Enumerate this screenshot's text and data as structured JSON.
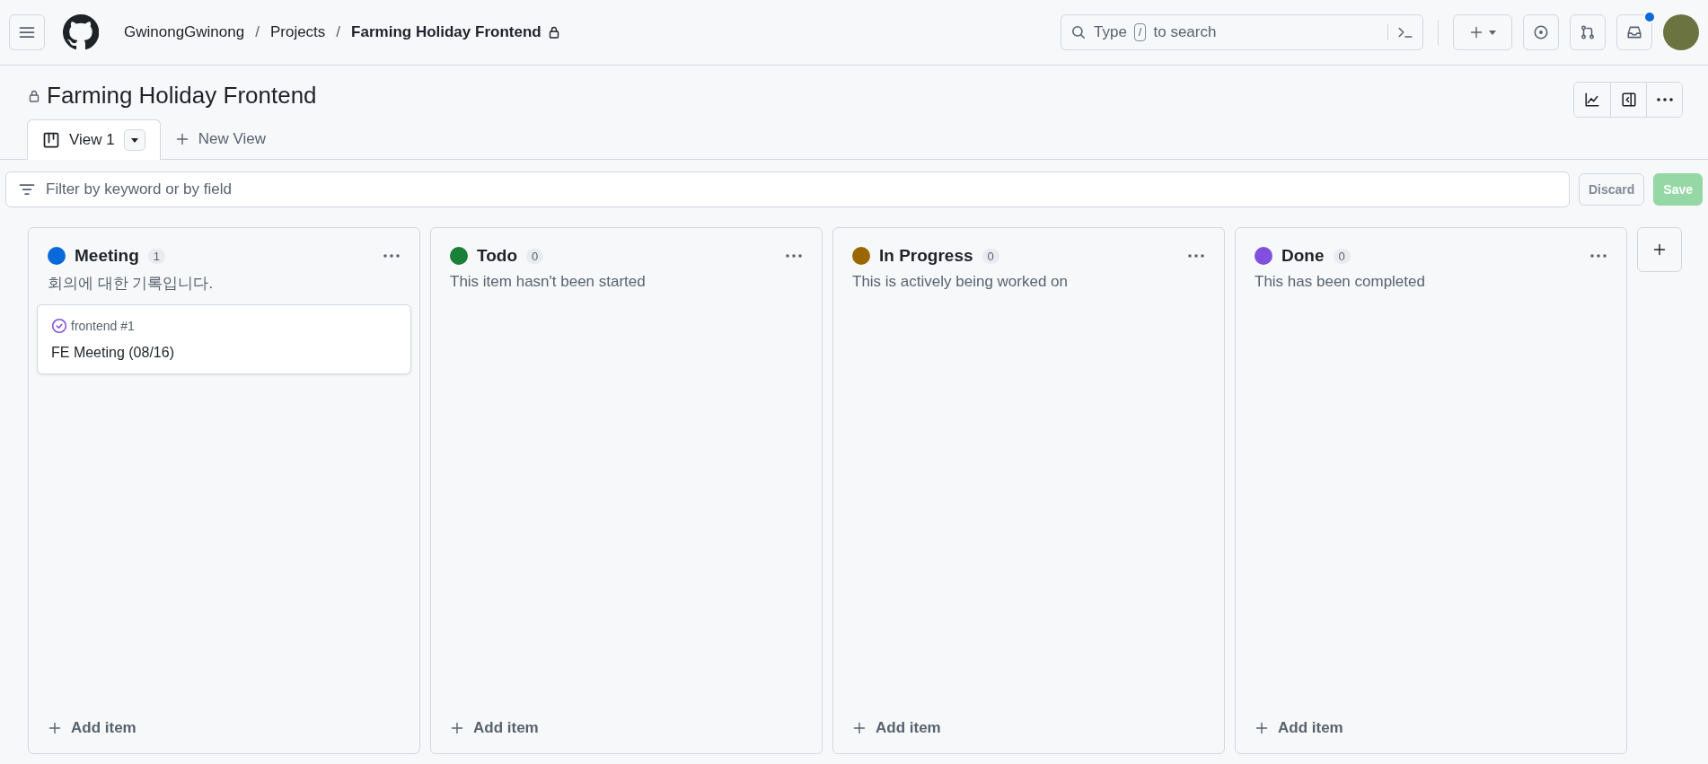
{
  "breadcrumbs": [
    {
      "label": "GwinongGwinong",
      "current": false
    },
    {
      "label": "Projects",
      "current": false
    },
    {
      "label": "Farming Holiday Frontend",
      "current": true
    }
  ],
  "separator": "/",
  "search": {
    "prefix": "Type",
    "key": "/",
    "suffix": "to search"
  },
  "notifications": {
    "unread": true
  },
  "project": {
    "title": "Farming Holiday Frontend",
    "private": true
  },
  "tabs": [
    {
      "label": "View 1",
      "selected": true
    }
  ],
  "new_view": {
    "label": "New View"
  },
  "filter": {
    "placeholder": "Filter by keyword or by field"
  },
  "actions": {
    "discard": "Discard",
    "save": "Save",
    "save_disabled": true
  },
  "columns": [
    {
      "name": "Meeting",
      "count": "1",
      "color": "#0969da",
      "description": "회의에 대한 기록입니다.",
      "add_label": "Add item",
      "cards": [
        {
          "repo": "frontend #1",
          "title": "FE Meeting (08/16)",
          "closed": true
        }
      ]
    },
    {
      "name": "Todo",
      "count": "0",
      "color": "#1a7f37",
      "description": "This item hasn't been started",
      "add_label": "Add item"
    },
    {
      "name": "In Progress",
      "count": "0",
      "color": "#9a6700",
      "description": "This is actively being worked on",
      "add_label": "Add item"
    },
    {
      "name": "Done",
      "count": "0",
      "color": "#8250df",
      "description": "This has been completed",
      "add_label": "Add item"
    }
  ]
}
